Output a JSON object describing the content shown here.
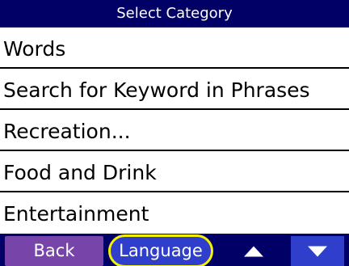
{
  "header": {
    "title": "Select Category"
  },
  "categories": [
    {
      "label": "Words"
    },
    {
      "label": "Search for Keyword in Phrases"
    },
    {
      "label": "Recreation..."
    },
    {
      "label": "Food and Drink"
    },
    {
      "label": "Entertainment"
    }
  ],
  "footer": {
    "back_label": "Back",
    "language_label": "Language",
    "scroll_up_icon": "up-arrow-icon",
    "scroll_down_icon": "down-arrow-icon"
  },
  "colors": {
    "header_bg": "#000066",
    "back_button": "#7744aa",
    "language_button": "#2f3fcc",
    "highlight_ring": "#f5f200",
    "scroll_down_button": "#2f3fcc"
  }
}
